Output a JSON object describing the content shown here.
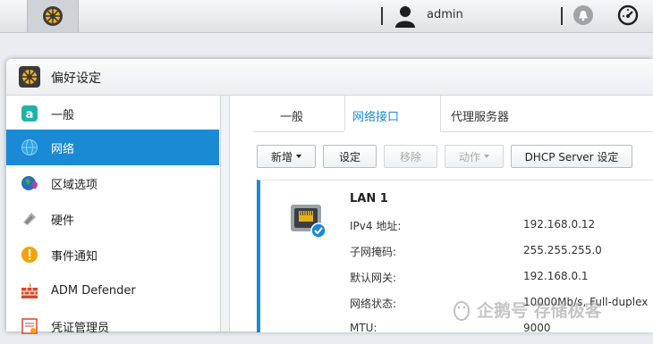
{
  "topbar": {
    "user": "admin"
  },
  "window": {
    "title": "偏好设定"
  },
  "sidebar": {
    "items": [
      {
        "label": "一般",
        "icon": "general-icon"
      },
      {
        "label": "网络",
        "icon": "globe-icon",
        "active": true
      },
      {
        "label": "区域选项",
        "icon": "region-icon"
      },
      {
        "label": "硬件",
        "icon": "hardware-icon"
      },
      {
        "label": "事件通知",
        "icon": "notification-icon"
      },
      {
        "label": "ADM Defender",
        "icon": "firewall-icon"
      },
      {
        "label": "凭证管理员",
        "icon": "certificate-icon"
      }
    ]
  },
  "tabs": [
    {
      "label": "一般"
    },
    {
      "label": "网络接口",
      "active": true
    },
    {
      "label": "代理服务器"
    }
  ],
  "toolbar": {
    "add": "新增",
    "settings": "设定",
    "remove": "移除",
    "action": "动作",
    "dhcp": "DHCP Server 设定"
  },
  "lan": {
    "name": "LAN 1",
    "fields": [
      {
        "label": "IPv4 地址:",
        "value": "192.168.0.12"
      },
      {
        "label": "子网掩码:",
        "value": "255.255.255.0"
      },
      {
        "label": "默认网关:",
        "value": "192.168.0.1"
      },
      {
        "label": "网络状态:",
        "value": "10000Mb/s, Full-duplex"
      },
      {
        "label": "MTU:",
        "value": "9000"
      }
    ]
  },
  "watermark": "企鹅号 存储极客",
  "colors": {
    "accent": "#1b8ad5"
  }
}
